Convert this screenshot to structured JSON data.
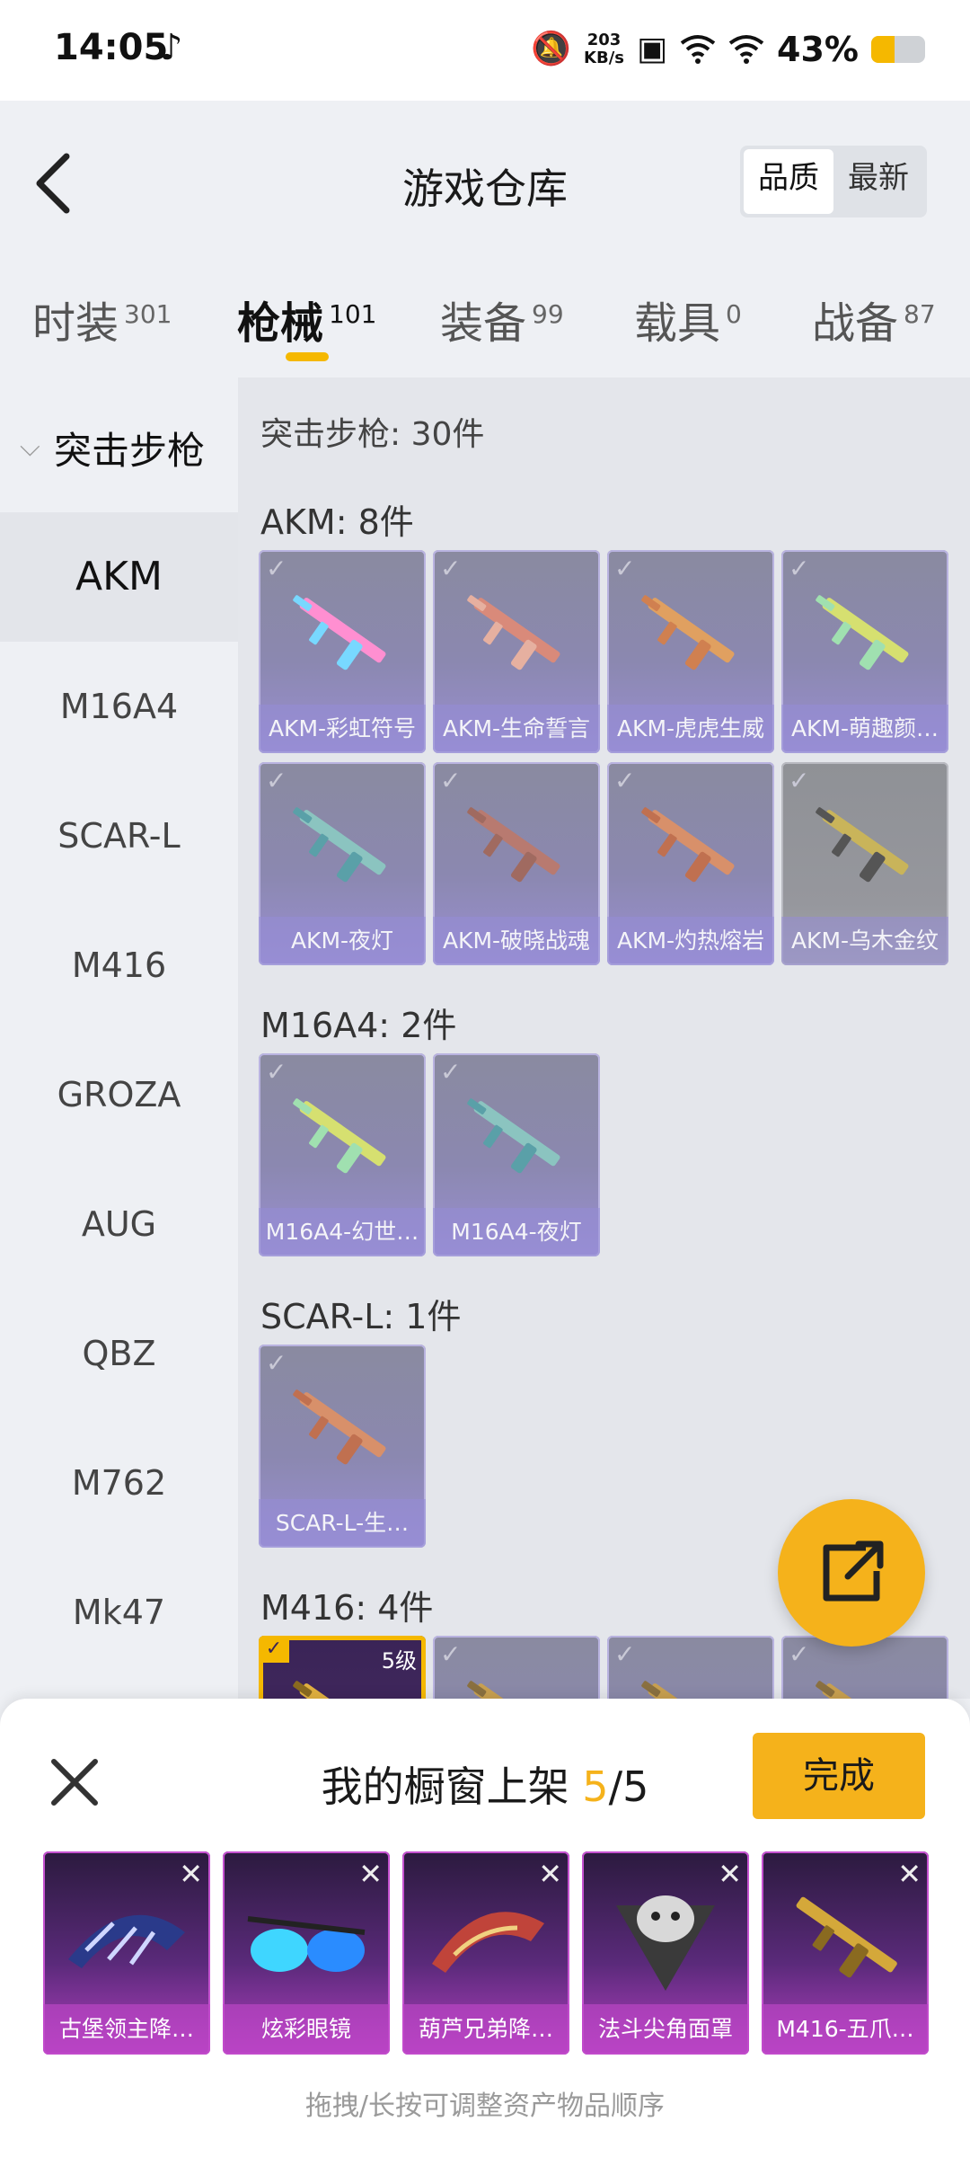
{
  "status_bar": {
    "time": "14:05",
    "net_speed_value": "203",
    "net_speed_unit": "KB/s",
    "battery": "43%"
  },
  "header": {
    "title": "游戏仓库",
    "sort_options": [
      "品质",
      "最新"
    ],
    "selected_sort": "品质"
  },
  "tabs": [
    {
      "label": "时装",
      "count": "301"
    },
    {
      "label": "枪械",
      "count": "101",
      "active": true
    },
    {
      "label": "装备",
      "count": "99"
    },
    {
      "label": "载具",
      "count": "0"
    },
    {
      "label": "战备",
      "count": "87"
    }
  ],
  "sidebar": {
    "category": "突击步枪",
    "items": [
      "AKM",
      "M16A4",
      "SCAR-L",
      "M416",
      "GROZA",
      "AUG",
      "QBZ",
      "M762",
      "Mk47"
    ],
    "selected": "AKM"
  },
  "content": {
    "total": "突击步枪: 30件",
    "groups": [
      {
        "title": "AKM: 8件",
        "items": [
          "AKM-彩虹符号",
          "AKM-生命誓言",
          "AKM-虎虎生威",
          "AKM-萌趣颜…",
          "AKM-夜灯",
          "AKM-破晓战魂",
          "AKM-灼热熔岩",
          "AKM-乌木金纹"
        ]
      },
      {
        "title": "M16A4: 2件",
        "items": [
          "M16A4-幻世…",
          "M16A4-夜灯"
        ]
      },
      {
        "title": "SCAR-L: 1件",
        "items": [
          "SCAR-L-生…"
        ]
      },
      {
        "title": "M416: 4件",
        "items": [],
        "first_item_level": "5级"
      }
    ]
  },
  "bottom_sheet": {
    "title_prefix": "我的橱窗上架",
    "count_current": "5",
    "count_sep": "/",
    "count_total": "5",
    "done_label": "完成",
    "items": [
      "古堡领主降…",
      "炫彩眼镜",
      "葫芦兄弟降…",
      "法斗尖角面罩",
      "M416-五爪…"
    ],
    "hint": "拖拽/长按可调整资产物品顺序"
  },
  "colors": {
    "accent": "#f5b21b",
    "item_purple": "#9a8fd2",
    "showcase_magenta": "#b23fc0"
  }
}
